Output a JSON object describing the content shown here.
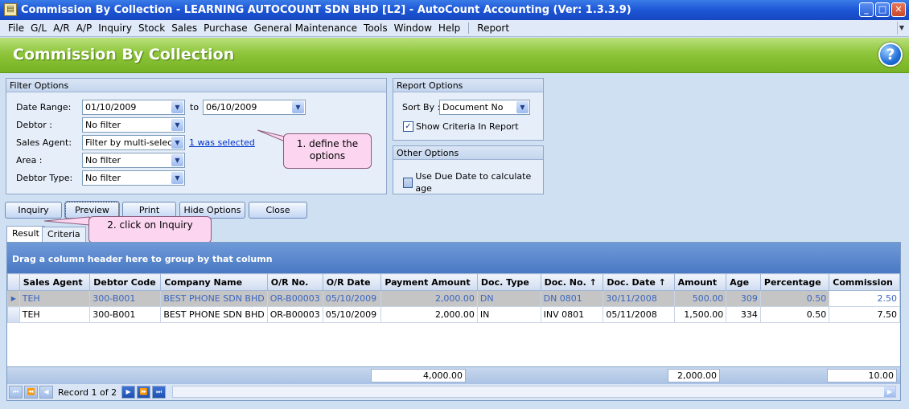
{
  "window": {
    "title": "Commission By Collection - LEARNING AUTOCOUNT SDN BHD [L2] - AutoCount Accounting (Ver: 1.3.3.9)",
    "icon": "app-icon"
  },
  "menu": {
    "items": [
      "File",
      "G/L",
      "A/R",
      "A/P",
      "Inquiry",
      "Stock",
      "Sales",
      "Purchase",
      "General Maintenance",
      "Tools",
      "Window",
      "Help"
    ],
    "report": "Report"
  },
  "header": {
    "title": "Commission By Collection",
    "help": "?"
  },
  "filter": {
    "title": "Filter Options",
    "date_range_label": "Date Range:",
    "date_from": "01/10/2009",
    "to_label": "to",
    "date_to": "06/10/2009",
    "debtor_label": "Debtor :",
    "debtor_value": "No filter",
    "agent_label": "Sales Agent:",
    "agent_value": "Filter by multi-select",
    "agent_link": "1 was selected",
    "area_label": "Area :",
    "area_value": "No filter",
    "debtor_type_label": "Debtor Type:",
    "debtor_type_value": "No filter"
  },
  "report_options": {
    "title": "Report Options",
    "sort_label": "Sort By :",
    "sort_value": "Document No",
    "show_criteria_label": "Show Criteria In Report",
    "show_criteria_checked": true
  },
  "other_options": {
    "title": "Other Options",
    "due_date_label": "Use Due Date to calculate age",
    "due_date_checked": false
  },
  "callouts": {
    "one": "1. define the options",
    "two": "2. click on Inquiry"
  },
  "buttons": {
    "inquiry": "Inquiry",
    "preview": "Preview",
    "print": "Print",
    "hide_options": "Hide Options",
    "close": "Close"
  },
  "tabs": {
    "result": "Result",
    "criteria": "Criteria"
  },
  "grid": {
    "group_panel": "Drag a column header here to group by that column",
    "columns": [
      "Sales Agent",
      "Debtor Code",
      "Company Name",
      "O/R No.",
      "O/R Date",
      "Payment Amount",
      "Doc. Type",
      "Doc. No.",
      "Doc. Date",
      "Amount",
      "Age",
      "Percentage",
      "Commission"
    ],
    "sort_arrows": [
      "",
      "",
      "",
      "",
      "",
      "",
      "",
      "↑",
      "↑",
      "",
      "",
      "",
      ""
    ],
    "rows": [
      [
        "TEH",
        "300-B001",
        "BEST PHONE SDN BHD",
        "OR-B00003",
        "05/10/2009",
        "2,000.00",
        "DN",
        "DN 0801",
        "30/11/2008",
        "500.00",
        "309",
        "0.50",
        "2.50"
      ],
      [
        "TEH",
        "300-B001",
        "BEST PHONE SDN BHD",
        "OR-B00003",
        "05/10/2009",
        "2,000.00",
        "IN",
        "INV 0801",
        "05/11/2008",
        "1,500.00",
        "334",
        "0.50",
        "7.50"
      ]
    ],
    "totals": {
      "payment": "4,000.00",
      "amount": "2,000.00",
      "commission": "10.00"
    },
    "record_text": "Record 1 of 2"
  }
}
